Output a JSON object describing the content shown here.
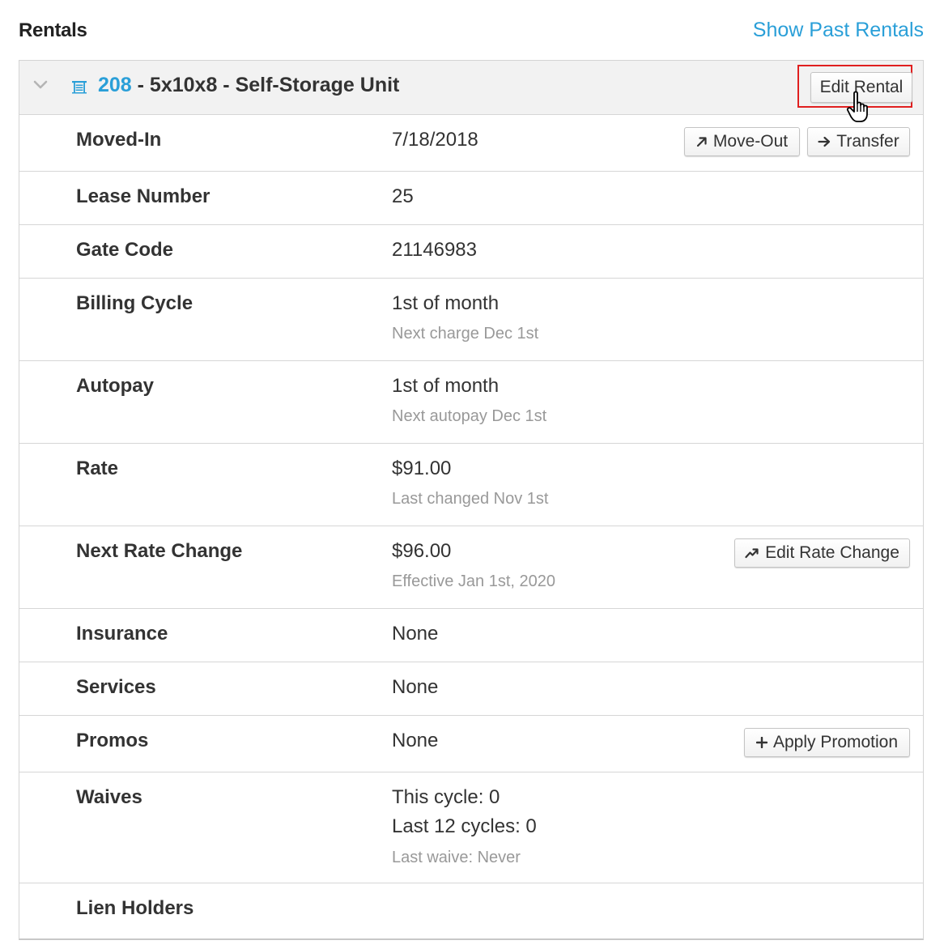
{
  "header": {
    "title": "Rentals",
    "show_past_link": "Show Past Rentals"
  },
  "rental": {
    "unit_number": "208",
    "unit_desc": " - 5x10x8 - Self-Storage Unit",
    "edit_button": "Edit Rental",
    "rows": {
      "moved_in": {
        "label": "Moved-In",
        "value": "7/18/2018",
        "move_out_button": "Move-Out",
        "transfer_button": "Transfer"
      },
      "lease": {
        "label": "Lease Number",
        "value": "25"
      },
      "gate": {
        "label": "Gate Code",
        "value": "21146983"
      },
      "billing": {
        "label": "Billing Cycle",
        "value": "1st of month",
        "sub": "Next charge Dec 1st"
      },
      "autopay": {
        "label": "Autopay",
        "value": "1st of month",
        "sub": "Next autopay Dec 1st"
      },
      "rate": {
        "label": "Rate",
        "value": "$91.00",
        "sub": "Last changed Nov 1st"
      },
      "next_rate": {
        "label": "Next Rate Change",
        "value": "$96.00",
        "sub": "Effective Jan 1st, 2020",
        "button": "Edit Rate Change"
      },
      "insurance": {
        "label": "Insurance",
        "value": "None"
      },
      "services": {
        "label": "Services",
        "value": "None"
      },
      "promos": {
        "label": "Promos",
        "value": "None",
        "button": "Apply Promotion"
      },
      "waives": {
        "label": "Waives",
        "this_cycle": "This cycle: 0",
        "last_12": "Last 12 cycles: 0",
        "sub": "Last waive: Never"
      },
      "lien": {
        "label": "Lien Holders"
      }
    }
  },
  "colors": {
    "accent": "#2a9fd8",
    "highlight": "#e01f1f",
    "muted": "#999999"
  },
  "icons": [
    "chevron-down-icon",
    "storage-unit-icon",
    "arrow-up-right-icon",
    "arrow-right-icon",
    "trend-up-icon",
    "plus-icon",
    "hand-cursor-icon"
  ]
}
